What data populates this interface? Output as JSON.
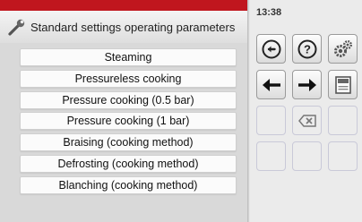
{
  "header": {
    "title": "Standard settings operating parameters",
    "accent_color": "#c0161e"
  },
  "status": {
    "time": "13:38"
  },
  "parameters": [
    "Steaming",
    "Pressureless cooking",
    "Pressure cooking (0.5 bar)",
    "Pressure cooking (1 bar)",
    "Braising (cooking method)",
    "Defrosting (cooking method)",
    "Blanching (cooking method)"
  ],
  "keypad": {
    "buttons": [
      {
        "icon": "back-circle-icon",
        "enabled": true
      },
      {
        "icon": "help-icon",
        "enabled": true
      },
      {
        "icon": "settings-gears-icon",
        "enabled": true
      },
      {
        "icon": "arrow-left-icon",
        "enabled": true
      },
      {
        "icon": "arrow-right-icon",
        "enabled": true
      },
      {
        "icon": "save-disk-icon",
        "enabled": true
      },
      {
        "icon": "backspace-icon",
        "enabled": false
      }
    ]
  }
}
